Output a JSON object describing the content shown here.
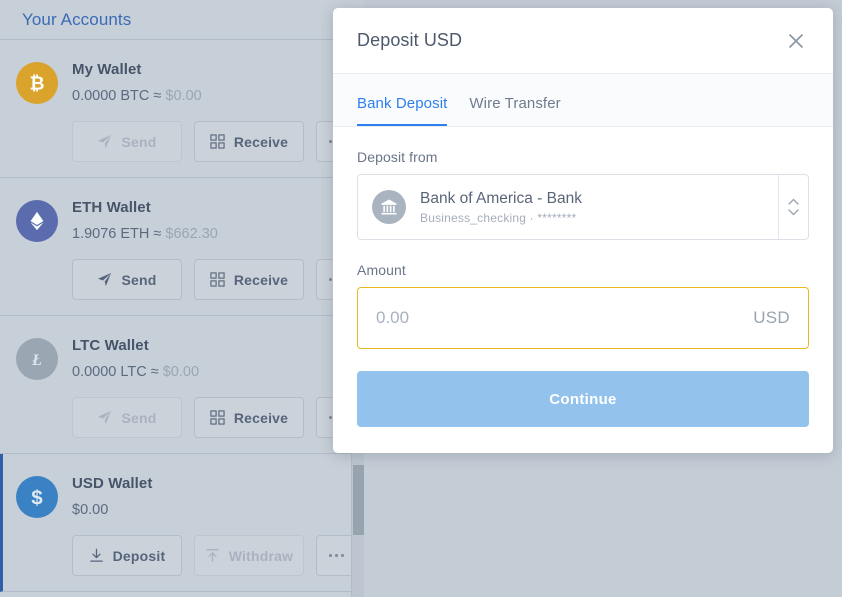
{
  "accounts_panel": {
    "header_title": "Your Accounts",
    "wallets": [
      {
        "name": "My Wallet",
        "icon": "bitcoin-icon",
        "balance_crypto": "0.0000 BTC",
        "approx_symbol": "≈",
        "balance_fiat": "$0.00",
        "selected": false,
        "actions": [
          {
            "label": "Send",
            "icon": "send-icon",
            "disabled": true
          },
          {
            "label": "Receive",
            "icon": "qr-code-icon",
            "disabled": false
          },
          {
            "label": "",
            "icon": "more-options-icon",
            "disabled": false
          }
        ]
      },
      {
        "name": "ETH Wallet",
        "icon": "ethereum-icon",
        "balance_crypto": "1.9076 ETH",
        "approx_symbol": "≈",
        "balance_fiat": "$662.30",
        "selected": false,
        "actions": [
          {
            "label": "Send",
            "icon": "send-icon",
            "disabled": false
          },
          {
            "label": "Receive",
            "icon": "qr-code-icon",
            "disabled": false
          },
          {
            "label": "",
            "icon": "more-options-icon",
            "disabled": false
          }
        ]
      },
      {
        "name": "LTC Wallet",
        "icon": "litecoin-icon",
        "balance_crypto": "0.0000 LTC",
        "approx_symbol": "≈",
        "balance_fiat": "$0.00",
        "selected": false,
        "actions": [
          {
            "label": "Send",
            "icon": "send-icon",
            "disabled": true
          },
          {
            "label": "Receive",
            "icon": "qr-code-icon",
            "disabled": false
          },
          {
            "label": "",
            "icon": "more-options-icon",
            "disabled": false
          }
        ]
      },
      {
        "name": "USD Wallet",
        "icon": "usd-dollar-icon",
        "balance_crypto": "$0.00",
        "approx_symbol": "",
        "balance_fiat": "",
        "selected": true,
        "actions": [
          {
            "label": "Deposit",
            "icon": "download-arrow-icon",
            "disabled": false
          },
          {
            "label": "Withdraw",
            "icon": "upload-arrow-icon",
            "disabled": true
          },
          {
            "label": "",
            "icon": "more-options-icon",
            "disabled": false
          }
        ]
      }
    ]
  },
  "modal": {
    "title": "Deposit USD",
    "close_icon": "close-icon",
    "tabs": [
      {
        "label": "Bank Deposit",
        "active": true
      },
      {
        "label": "Wire Transfer",
        "active": false
      }
    ],
    "deposit_from": {
      "label": "Deposit from",
      "bank_icon": "bank-building-icon",
      "bank_name": "Bank of America - Bank",
      "account_detail": "Business_checking · ********",
      "stepper_icon": "chevron-updown-icon"
    },
    "amount": {
      "label": "Amount",
      "value": "",
      "placeholder": "0.00",
      "currency": "USD"
    },
    "continue_label": "Continue"
  },
  "colors": {
    "accent_blue": "#2d7ff0",
    "link_blue": "#3b6bb5",
    "selected_border": "#2f5fa8",
    "amount_focus_border": "#e8b923",
    "continue_bg": "#93c3ec",
    "btc": "#d9a32c",
    "eth": "#5b6cae",
    "ltc": "#9aa6b2",
    "usd": "#3b82c4",
    "panel_bg": "#c7cfd8",
    "content_bg": "#c4ccd6"
  }
}
